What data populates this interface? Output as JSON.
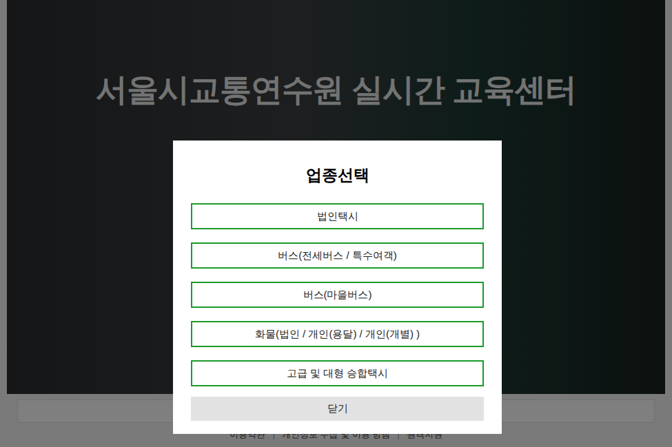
{
  "page": {
    "title": "서울시교통연수원 실시간 교육센터"
  },
  "footer": {
    "links": [
      "이용약관",
      "개인정보 수집 및 이용 방침",
      "원격지원"
    ],
    "separator": "|"
  },
  "dialog": {
    "title": "업종선택",
    "options": [
      "법인택시",
      "버스(전세버스 / 특수여객)",
      "버스(마을버스)",
      "화물(법인 / 개인(용달) / 개인(개별) )",
      "고급 및 대형 승합택시"
    ],
    "close": "닫기"
  }
}
